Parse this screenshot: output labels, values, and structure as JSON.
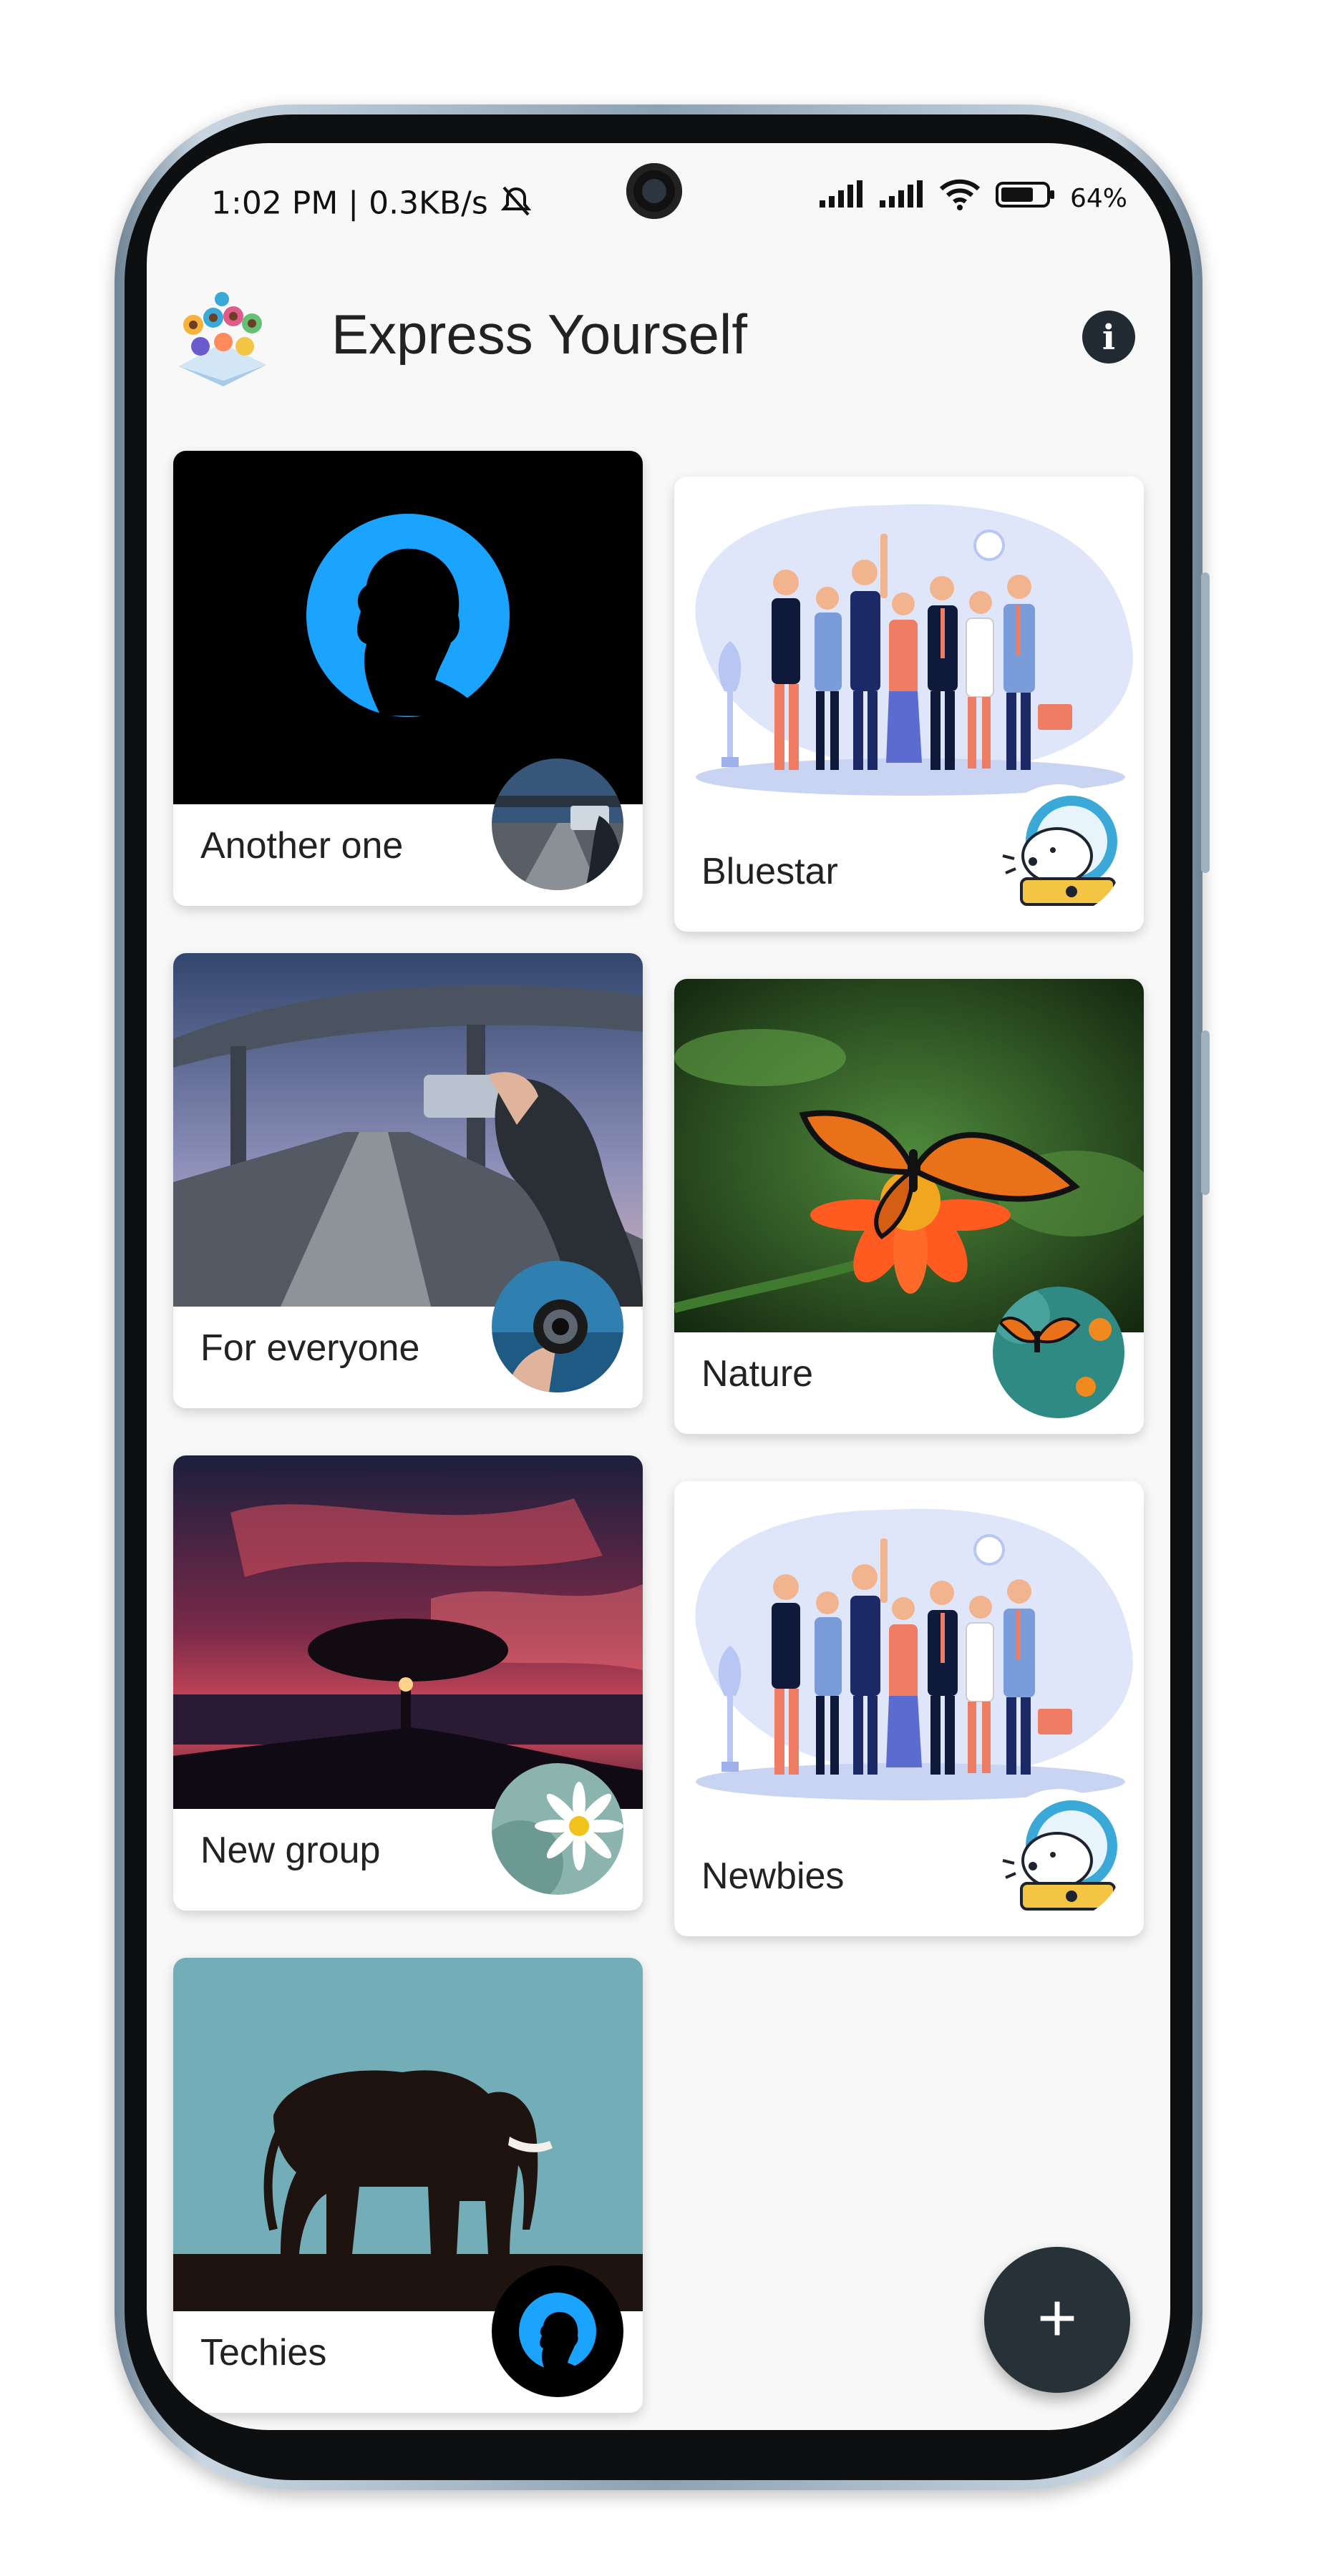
{
  "status_bar": {
    "left_text": "1:02 PM | 0.3KB/s",
    "battery": "64%",
    "icons": [
      "mute-icon",
      "signal-icon",
      "signal-icon",
      "wifi-icon",
      "battery-icon"
    ]
  },
  "app_bar": {
    "title": "Express Yourself",
    "info_icon": "info-icon"
  },
  "groups": [
    {
      "name": "Another one"
    },
    {
      "name": "Bluestar"
    },
    {
      "name": "For everyone"
    },
    {
      "name": "Nature"
    },
    {
      "name": "New group"
    },
    {
      "name": "Newbies"
    },
    {
      "name": "Techies"
    }
  ],
  "fab": {
    "label": "+"
  },
  "colors": {
    "accent": "#263238",
    "background": "#f8f8f8"
  }
}
